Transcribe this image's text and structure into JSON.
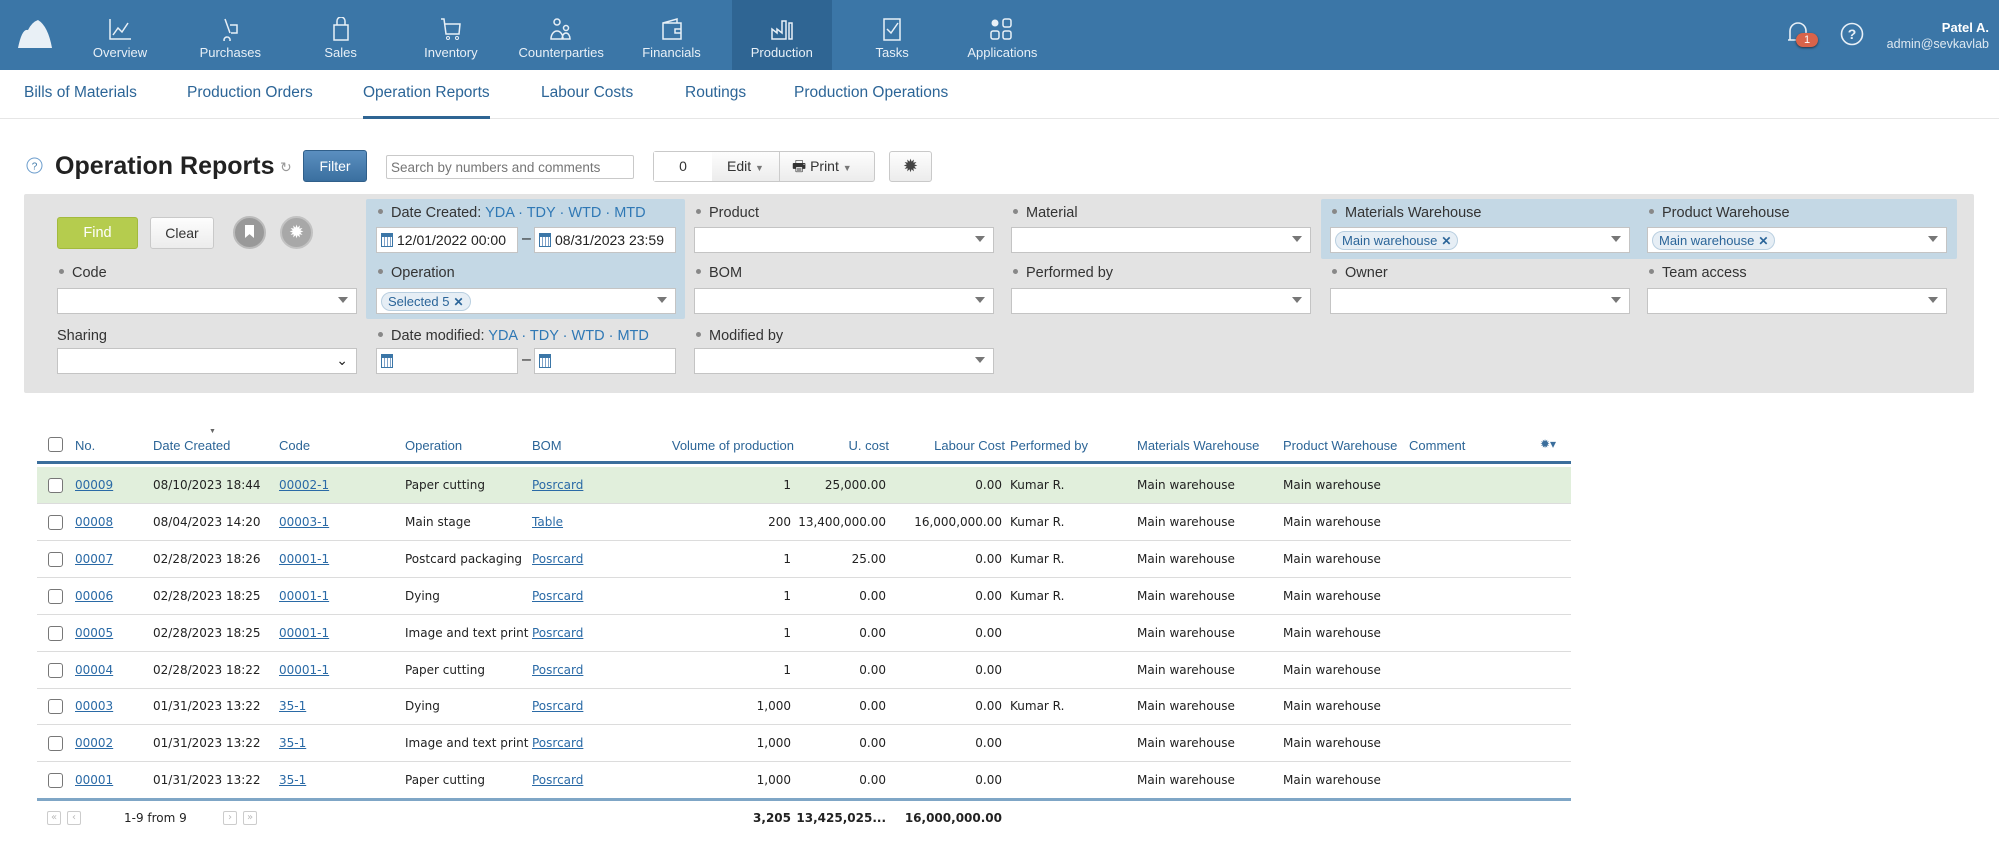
{
  "topnav": {
    "items": [
      {
        "label": "Overview",
        "icon": "chart-line-icon"
      },
      {
        "label": "Purchases",
        "icon": "cart-dolly-icon"
      },
      {
        "label": "Sales",
        "icon": "shopping-bag-icon"
      },
      {
        "label": "Inventory",
        "icon": "shopping-cart-icon"
      },
      {
        "label": "Counterparties",
        "icon": "people-icon"
      },
      {
        "label": "Financials",
        "icon": "wallet-icon"
      },
      {
        "label": "Production",
        "icon": "factory-icon",
        "active": true
      },
      {
        "label": "Tasks",
        "icon": "checkbox-icon"
      },
      {
        "label": "Applications",
        "icon": "apps-grid-icon"
      }
    ],
    "notifications_count": "1",
    "user_name": "Patel A.",
    "user_email": "admin@sevkavlab"
  },
  "subnav": {
    "items": [
      {
        "label": "Bills of Materials"
      },
      {
        "label": "Production Orders"
      },
      {
        "label": "Operation Reports",
        "active": true
      },
      {
        "label": "Labour Costs"
      },
      {
        "label": "Routings"
      },
      {
        "label": "Production Operations"
      }
    ]
  },
  "toolbar": {
    "title": "Operation Reports",
    "filter_label": "Filter",
    "search_placeholder": "Search by numbers and comments",
    "selected_count": "0",
    "edit_label": "Edit",
    "print_label": "Print"
  },
  "filters": {
    "find_label": "Find",
    "clear_label": "Clear",
    "quick_dates": "YDA · TDY · WTD · MTD",
    "date_created": {
      "label": "Date Created:",
      "from": "12/01/2022 00:00",
      "to": "08/31/2023 23:59"
    },
    "date_modified": {
      "label": "Date modified:",
      "from": "",
      "to": ""
    },
    "product": {
      "label": "Product"
    },
    "material": {
      "label": "Material"
    },
    "materials_warehouse": {
      "label": "Materials Warehouse",
      "tag": "Main warehouse"
    },
    "product_warehouse": {
      "label": "Product Warehouse",
      "tag": "Main warehouse"
    },
    "code": {
      "label": "Code"
    },
    "operation": {
      "label": "Operation",
      "tag": "Selected 5"
    },
    "bom": {
      "label": "BOM"
    },
    "performed_by": {
      "label": "Performed by"
    },
    "owner": {
      "label": "Owner"
    },
    "team_access": {
      "label": "Team access"
    },
    "sharing": {
      "label": "Sharing"
    },
    "modified_by": {
      "label": "Modified by"
    }
  },
  "table": {
    "columns": [
      "No.",
      "Date Created",
      "Code",
      "Operation",
      "BOM",
      "Volume of production",
      "U. cost",
      "Labour Cost",
      "Performed by",
      "Materials Warehouse",
      "Product Warehouse",
      "Comment"
    ],
    "rows": [
      {
        "no": "00009",
        "date": "08/10/2023 18:44",
        "code": "00002-1",
        "operation": "Paper cutting",
        "bom": "Posrcard",
        "volume": "1",
        "ucost": "25,000.00",
        "labour": "0.00",
        "performed": "Kumar R.",
        "mwh": "Main warehouse",
        "pwh": "Main warehouse",
        "comment": ""
      },
      {
        "no": "00008",
        "date": "08/04/2023 14:20",
        "code": "00003-1",
        "operation": "Main stage",
        "bom": "Table",
        "volume": "200",
        "ucost": "13,400,000.00",
        "labour": "16,000,000.00",
        "performed": "Kumar R.",
        "mwh": "Main warehouse",
        "pwh": "Main warehouse",
        "comment": ""
      },
      {
        "no": "00007",
        "date": "02/28/2023 18:26",
        "code": "00001-1",
        "operation": "Postcard packaging",
        "bom": "Posrcard",
        "volume": "1",
        "ucost": "25.00",
        "labour": "0.00",
        "performed": "Kumar R.",
        "mwh": "Main warehouse",
        "pwh": "Main warehouse",
        "comment": ""
      },
      {
        "no": "00006",
        "date": "02/28/2023 18:25",
        "code": "00001-1",
        "operation": "Dying",
        "bom": "Posrcard",
        "volume": "1",
        "ucost": "0.00",
        "labour": "0.00",
        "performed": "Kumar R.",
        "mwh": "Main warehouse",
        "pwh": "Main warehouse",
        "comment": ""
      },
      {
        "no": "00005",
        "date": "02/28/2023 18:25",
        "code": "00001-1",
        "operation": "Image and text print",
        "bom": "Posrcard",
        "volume": "1",
        "ucost": "0.00",
        "labour": "0.00",
        "performed": "",
        "mwh": "Main warehouse",
        "pwh": "Main warehouse",
        "comment": ""
      },
      {
        "no": "00004",
        "date": "02/28/2023 18:22",
        "code": "00001-1",
        "operation": "Paper cutting",
        "bom": "Posrcard",
        "volume": "1",
        "ucost": "0.00",
        "labour": "0.00",
        "performed": "",
        "mwh": "Main warehouse",
        "pwh": "Main warehouse",
        "comment": ""
      },
      {
        "no": "00003",
        "date": "01/31/2023 13:22",
        "code": "35-1",
        "operation": "Dying",
        "bom": "Posrcard",
        "volume": "1,000",
        "ucost": "0.00",
        "labour": "0.00",
        "performed": "Kumar R.",
        "mwh": "Main warehouse",
        "pwh": "Main warehouse",
        "comment": ""
      },
      {
        "no": "00002",
        "date": "01/31/2023 13:22",
        "code": "35-1",
        "operation": "Image and text print",
        "bom": "Posrcard",
        "volume": "1,000",
        "ucost": "0.00",
        "labour": "0.00",
        "performed": "",
        "mwh": "Main warehouse",
        "pwh": "Main warehouse",
        "comment": ""
      },
      {
        "no": "00001",
        "date": "01/31/2023 13:22",
        "code": "35-1",
        "operation": "Paper cutting",
        "bom": "Posrcard",
        "volume": "1,000",
        "ucost": "0.00",
        "labour": "0.00",
        "performed": "",
        "mwh": "Main warehouse",
        "pwh": "Main warehouse",
        "comment": ""
      }
    ],
    "highlight_row": 0,
    "totals": {
      "volume": "3,205",
      "ucost": "13,425,025...",
      "labour": "16,000,000.00"
    },
    "pagination": "1-9 from 9"
  },
  "colors": {
    "nav": "#3b76a7",
    "nav_active": "#2f6593",
    "link": "#2a6aa6",
    "find": "#b5cc4e",
    "highlight": "#c4d8e5",
    "row_highlight": "#e1efdc",
    "badge": "#d9634a"
  }
}
